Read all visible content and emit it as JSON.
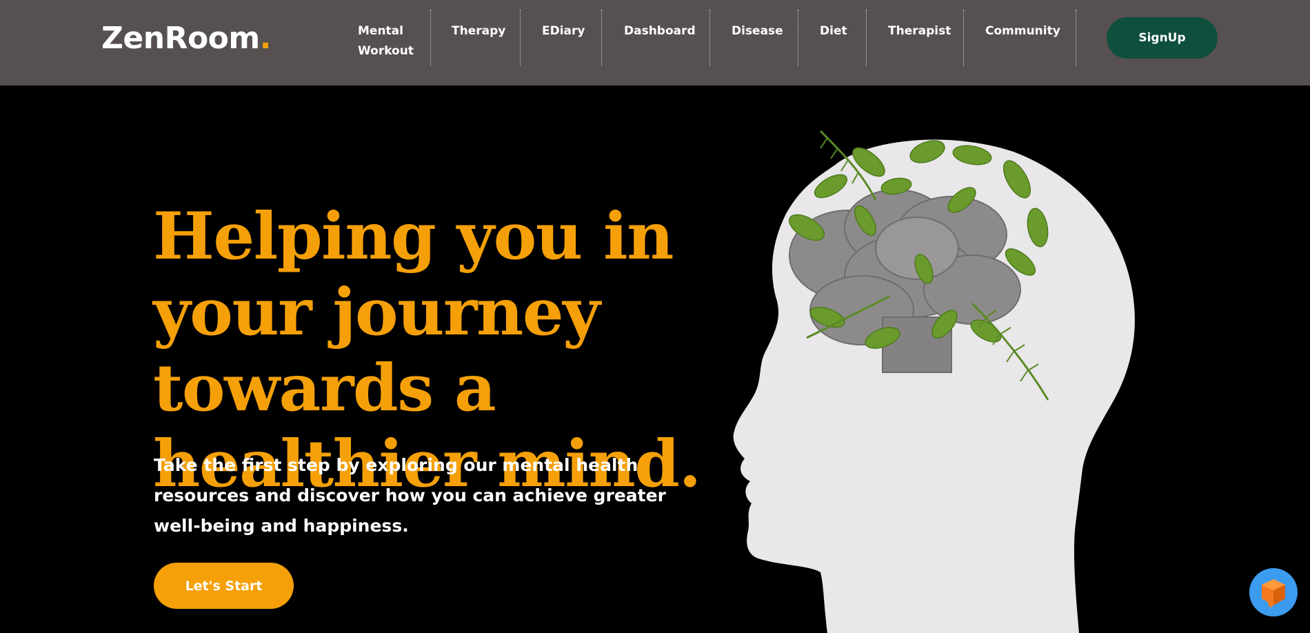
{
  "brand": {
    "name": "ZenRoom",
    "dot": "."
  },
  "nav": {
    "items": [
      {
        "label": "Mental Workout"
      },
      {
        "label": "Therapy"
      },
      {
        "label": "EDiary"
      },
      {
        "label": "Dashboard"
      },
      {
        "label": "Disease"
      },
      {
        "label": "Diet"
      },
      {
        "label": "Therapist"
      },
      {
        "label": "Community"
      }
    ],
    "signup_label": "SignUp"
  },
  "hero": {
    "headline": "Helping you in your journey towards a healthier mind.",
    "subtext": "Take the first step by exploring our mental health resources and discover how you can achieve greater well-being and happiness.",
    "cta_label": "Let's Start",
    "image": "head-silhouette-with-leaves-illustration"
  },
  "colors": {
    "header_bg": "#575051",
    "accent": "#f5a009",
    "signup_bg": "#0f4f3e",
    "page_bg": "#000000",
    "chat_widget": "#3b9bef"
  },
  "icons": {
    "chat_widget": "chat-bubble-cube-icon"
  }
}
